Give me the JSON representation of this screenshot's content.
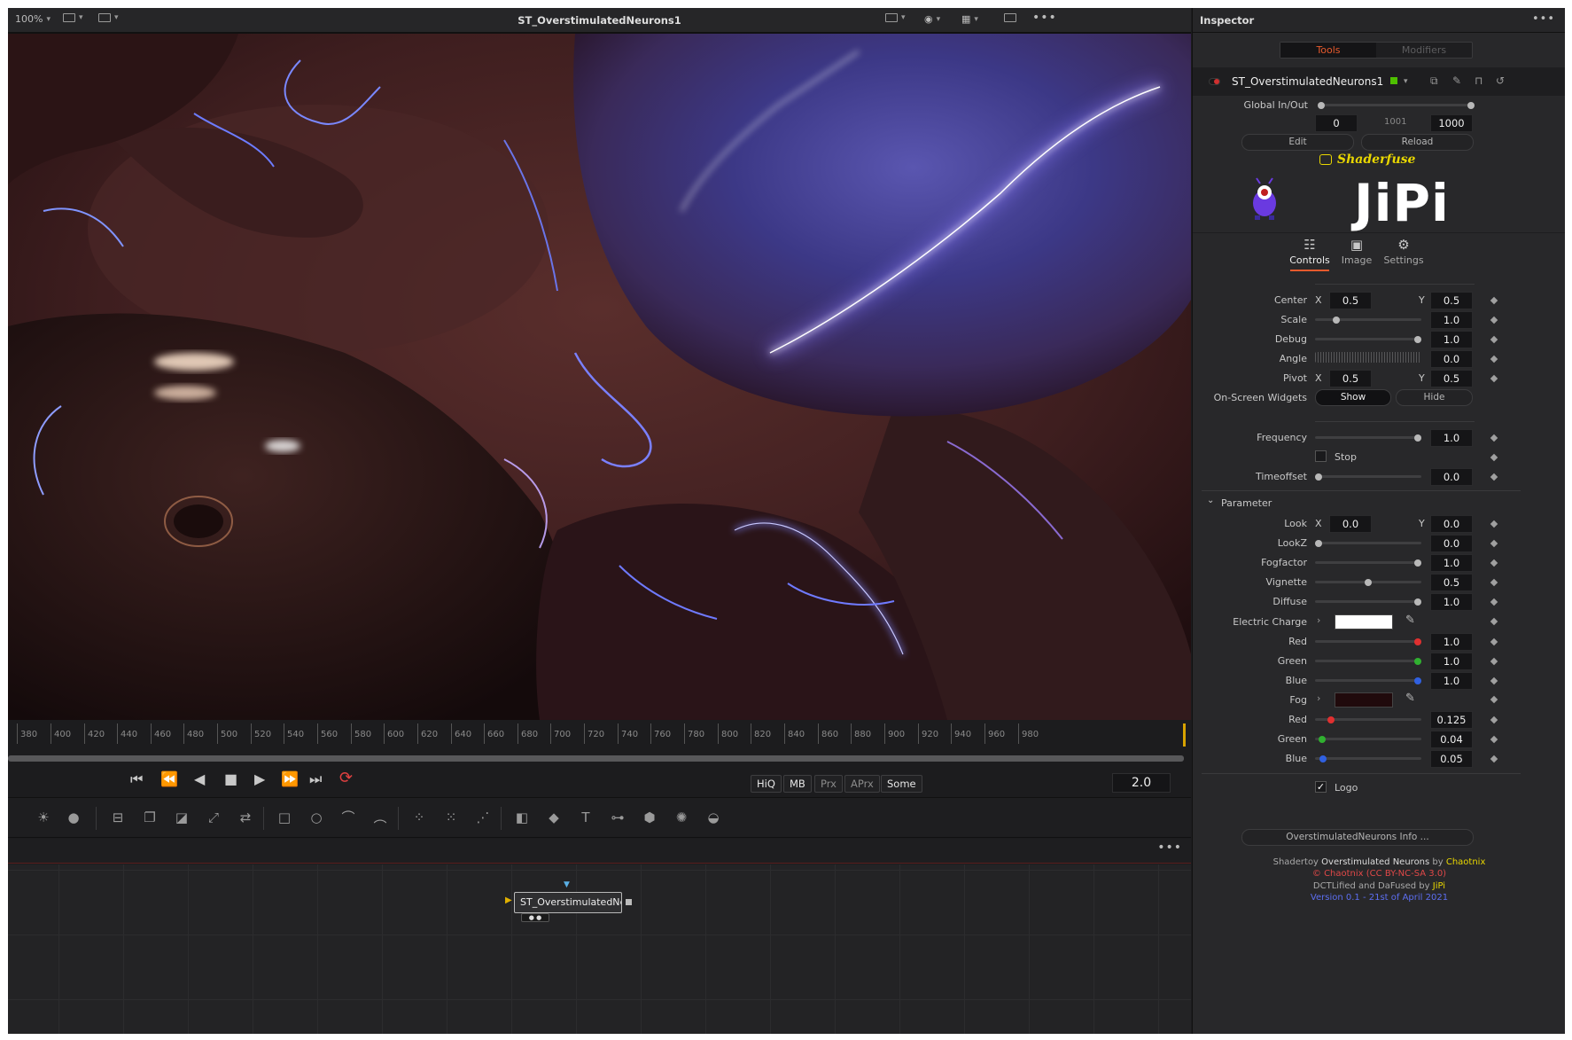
{
  "viewer": {
    "zoom": "100%",
    "title": "ST_OverstimulatedNeurons1",
    "ruler_ticks": [
      "380",
      "400",
      "420",
      "440",
      "460",
      "480",
      "500",
      "520",
      "540",
      "560",
      "580",
      "600",
      "620",
      "640",
      "660",
      "680",
      "700",
      "720",
      "740",
      "760",
      "780",
      "800",
      "820",
      "840",
      "860",
      "880",
      "900",
      "920",
      "940",
      "960",
      "980"
    ],
    "toggles": [
      "HiQ",
      "MB",
      "Prx",
      "APrx",
      "Some"
    ],
    "fps_value": "2.0"
  },
  "flow": {
    "node_label": "ST_OverstimulatedNe..."
  },
  "inspector": {
    "title": "Inspector",
    "tabs": [
      "Tools",
      "Modifiers"
    ],
    "node_name": "ST_OverstimulatedNeurons1",
    "global_inout_label": "Global In/Out",
    "global_in": "0",
    "global_mid": "1001",
    "global_out": "1000",
    "edit_label": "Edit",
    "reload_label": "Reload",
    "shaderfuse_label": "Shaderfuse",
    "logo_text": "JiPi",
    "view_tabs": [
      "Controls",
      "Image",
      "Settings"
    ],
    "controls": {
      "center_label": "Center",
      "center_x": "0.5",
      "center_y": "0.5",
      "scale_label": "Scale",
      "scale": "1.0",
      "debug_label": "Debug",
      "debug": "1.0",
      "angle_label": "Angle",
      "angle": "0.0",
      "pivot_label": "Pivot",
      "pivot_x": "0.5",
      "pivot_y": "0.5",
      "widgets_label": "On-Screen Widgets",
      "show_label": "Show",
      "hide_label": "Hide",
      "frequency_label": "Frequency",
      "frequency": "1.0",
      "stop_label": "Stop",
      "timeoffset_label": "Timeoffset",
      "timeoffset": "0.0",
      "x_label": "X",
      "y_label": "Y"
    },
    "parameter": {
      "section_label": "Parameter",
      "look_label": "Look",
      "look_x": "0.0",
      "look_y": "0.0",
      "lookz_label": "LookZ",
      "lookz": "0.0",
      "fogfactor_label": "Fogfactor",
      "fogfactor": "1.0",
      "vignette_label": "Vignette",
      "vignette": "0.5",
      "diffuse_label": "Diffuse",
      "diffuse": "1.0",
      "electric_label": "Electric Charge",
      "electric_color": "#ffffff",
      "red_label": "Red",
      "e_red": "1.0",
      "green_label": "Green",
      "e_green": "1.0",
      "blue_label": "Blue",
      "e_blue": "1.0",
      "fog_label": "Fog",
      "fog_color": "#200a0c",
      "f_red": "0.125",
      "f_green": "0.04",
      "f_blue": "0.05",
      "logo_label": "Logo"
    },
    "info_button": "OverstimulatedNeurons Info ...",
    "credits": {
      "l1a": "Shadertoy ",
      "l1b": "Overstimulated Neurons",
      "l1c": " by ",
      "l1d": "Chaotnix",
      "l2": "© Chaotnix (CC BY-NC-SA 3.0)",
      "l3a": "DCTLified and DaFused by ",
      "l3b": "JiPi",
      "l4": "Version 0.1 - 21st of April 2021"
    }
  },
  "colors": {
    "accent": "#e65a2d",
    "highlight": "#e9d700",
    "link": "#5c6ef0",
    "license": "#e04848"
  }
}
